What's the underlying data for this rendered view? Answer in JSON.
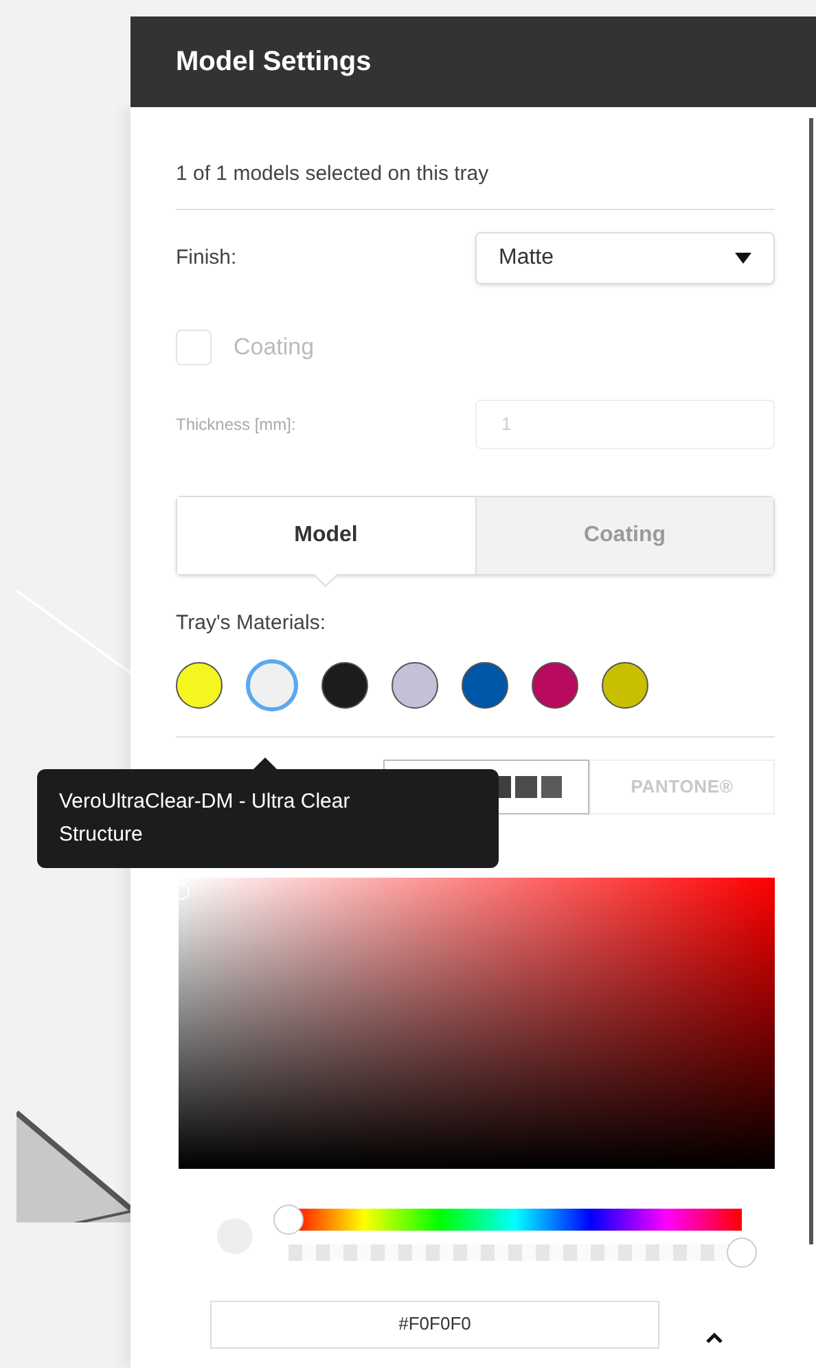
{
  "panel": {
    "title": "Model Settings",
    "selection_summary": "1 of 1 models selected on this tray"
  },
  "finish": {
    "label": "Finish:",
    "value": "Matte"
  },
  "coating": {
    "label": "Coating",
    "checked": false,
    "disabled": true
  },
  "thickness": {
    "label": "Thickness [mm]:",
    "value": "1",
    "disabled": true
  },
  "tabs": [
    {
      "label": "Model",
      "selected": true
    },
    {
      "label": "Coating",
      "selected": false
    }
  ],
  "materials": {
    "label": "Tray's Materials:",
    "swatches": [
      {
        "color": "#f5f520",
        "selected": false
      },
      {
        "color": "#f0f0f0",
        "selected": true
      },
      {
        "color": "#1c1c1e",
        "selected": false
      },
      {
        "color": "#c4c0d8",
        "selected": false
      },
      {
        "color": "#0057a8",
        "selected": false
      },
      {
        "color": "#b80a5e",
        "selected": false
      },
      {
        "color": "#c8bf00",
        "selected": false
      }
    ]
  },
  "tooltip": {
    "text": "VeroUltraClear-DM - Ultra Clear Structure"
  },
  "palette_modes": [
    {
      "kind": "swatches",
      "selected": true
    },
    {
      "kind": "pantone",
      "label": "PANTONE®",
      "selected": false
    }
  ],
  "color_picker": {
    "hue": {
      "level": 0
    },
    "alpha": {
      "level": 1
    },
    "hex": "#F0F0F0"
  }
}
